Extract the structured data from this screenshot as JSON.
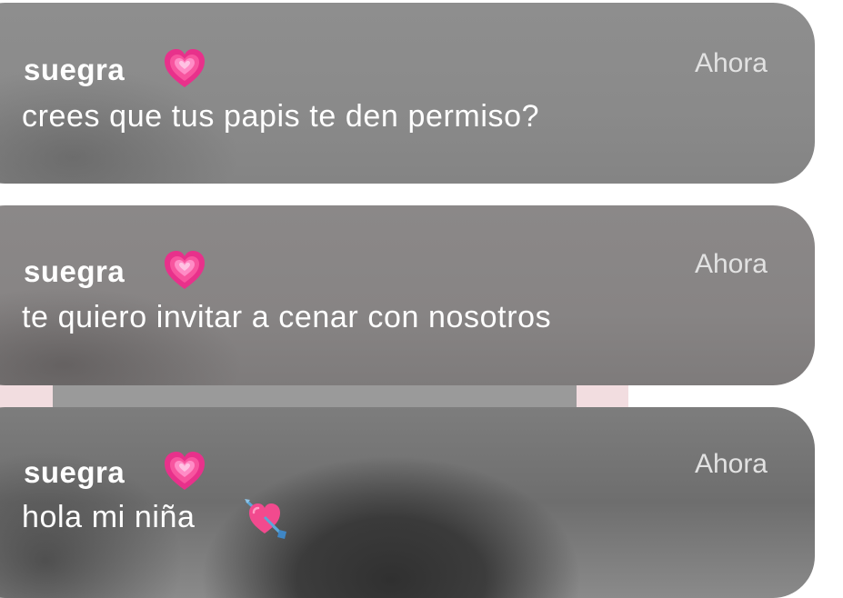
{
  "colors": {
    "heart_outer": "#e8318b",
    "heart_inner": "#ff9bd0",
    "pink_strip": "#f2dde0",
    "gray_strip": "#9a9a9a"
  },
  "notifications": [
    {
      "sender": "suegra",
      "sender_icon": "sparkling-heart-icon",
      "time": "Ahora",
      "message": "crees que tus papis te den permiso?"
    },
    {
      "sender": "suegra",
      "sender_icon": "sparkling-heart-icon",
      "time": "Ahora",
      "message": "te quiero invitar a cenar con nosotros"
    },
    {
      "sender": "suegra",
      "sender_icon": "sparkling-heart-icon",
      "time": "Ahora",
      "message": "hola mi niña",
      "message_icon": "heart-with-arrow-icon"
    }
  ]
}
